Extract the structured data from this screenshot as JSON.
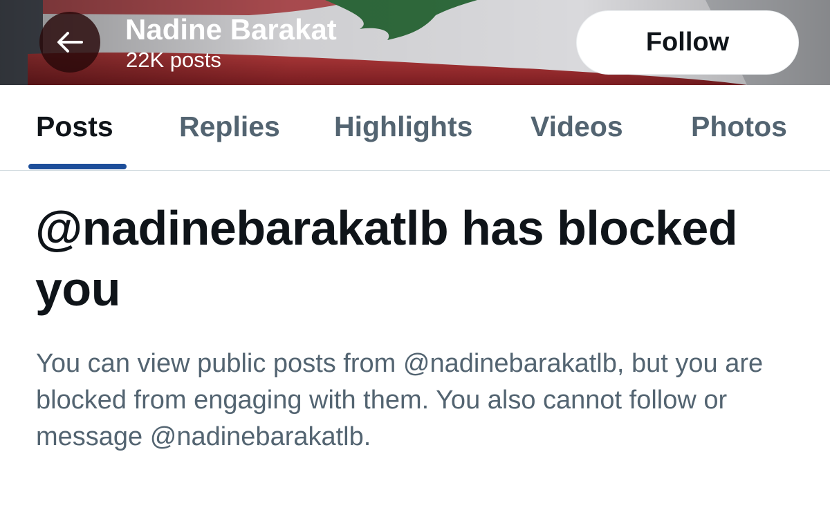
{
  "header": {
    "profile_name": "Nadine Barakat",
    "post_count": "22K posts",
    "follow_label": "Follow",
    "back_icon": "arrow-left-icon",
    "banner_colors": {
      "red": "#9c2a2c",
      "white": "#e9e7e6",
      "green": "#2f6a3c"
    }
  },
  "tabs": [
    {
      "label": "Posts",
      "active": true
    },
    {
      "label": "Replies",
      "active": false
    },
    {
      "label": "Highlights",
      "active": false
    },
    {
      "label": "Videos",
      "active": false
    },
    {
      "label": "Photos",
      "active": false
    }
  ],
  "notice": {
    "title": "@nadinebarakatlb has blocked you",
    "body": "You can view public posts from @nadinebarakatlb, but you are blocked from engaging with them. You also cannot follow or message @nadinebarakatlb."
  },
  "colors": {
    "accent": "#1d4e9a",
    "text_primary": "#0f1419",
    "text_secondary": "#536471",
    "divider": "#cfd9de"
  }
}
